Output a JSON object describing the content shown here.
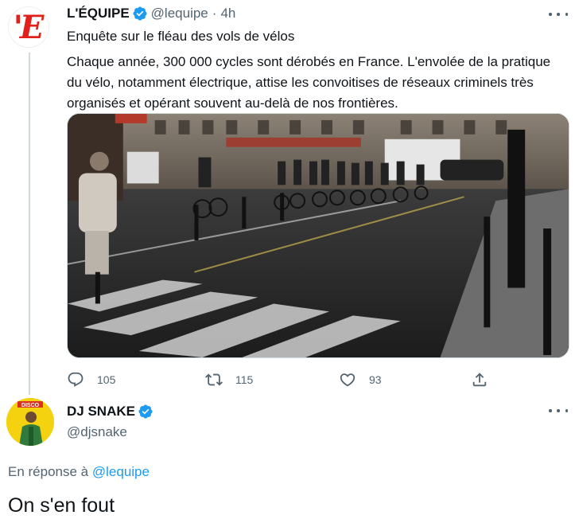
{
  "tweet": {
    "author_name": "L'ÉQUIPE",
    "author_handle": "@lequipe",
    "separator": "·",
    "time": "4h",
    "avatar_logo": "'E",
    "title": "Enquête sur le fléau des vols de vélos",
    "body": "Chaque année, 300 000 cycles sont dérobés en France. L'envolée de la pratique du vélo, notamment électrique, attise les convoitises de réseaux criminels très organisés et opérant souvent au-delà de nos frontières.",
    "actions": {
      "reply_count": "105",
      "retweet_count": "115",
      "like_count": "93"
    }
  },
  "reply": {
    "author_name": "DJ SNAKE",
    "author_handle": "@djsnake",
    "avatar_badge": "DISCO",
    "reply_prefix": "En réponse à",
    "reply_mention": "@lequipe",
    "text": "On s'en fout"
  },
  "colors": {
    "verified": "#1d9bf0",
    "muted": "#536471",
    "link": "#1d9bf0",
    "lequipe_red": "#e0201b",
    "dj_avatar_yellow": "#f4d20f"
  },
  "icons": [
    "verified-badge-icon",
    "more-options-icon",
    "reply-icon",
    "retweet-icon",
    "like-icon",
    "share-icon"
  ]
}
